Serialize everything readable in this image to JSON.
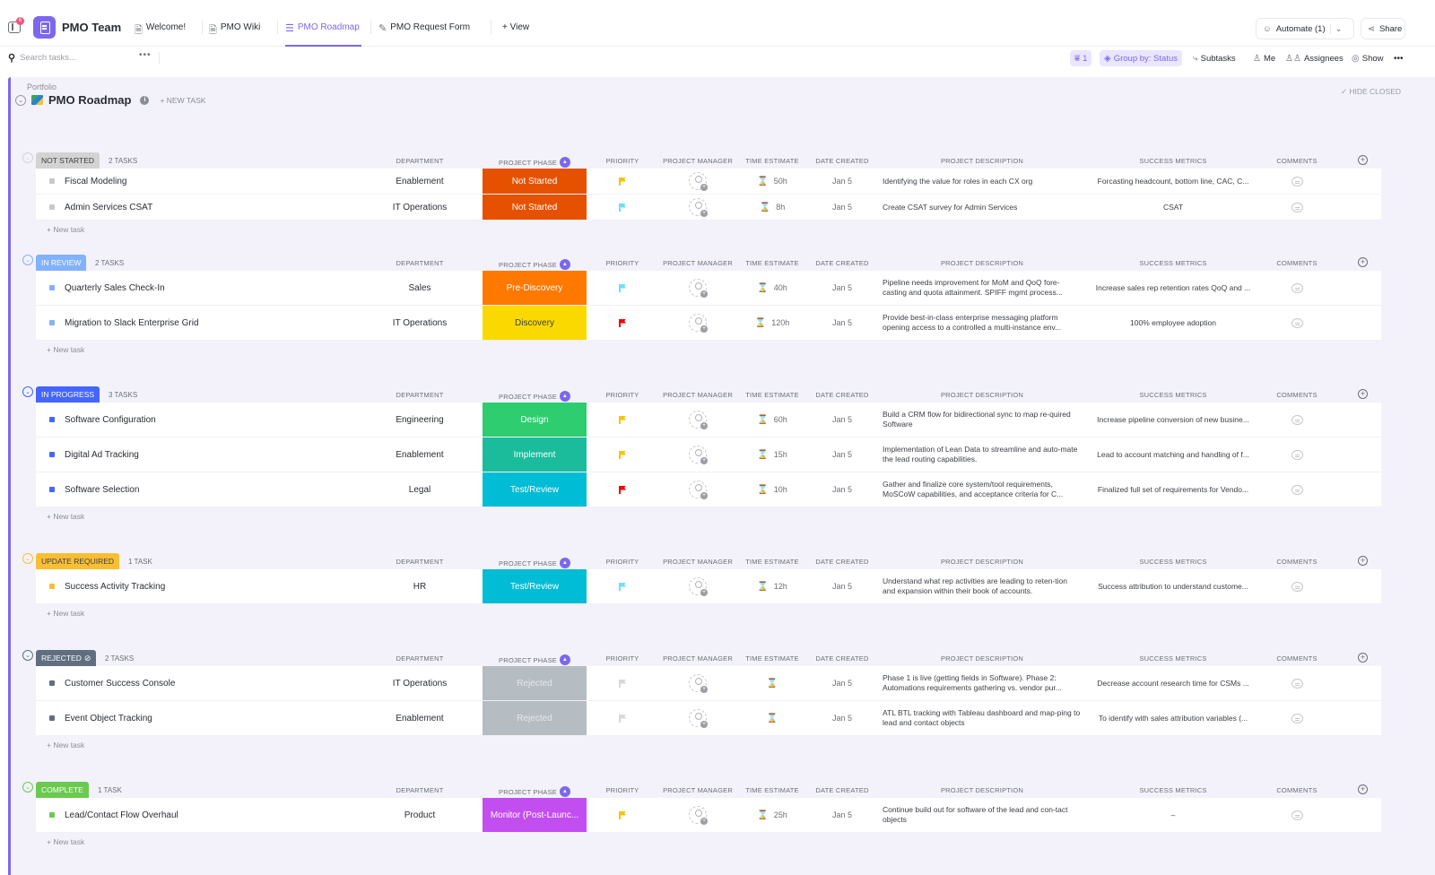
{
  "topbar": {
    "notification_count": "6",
    "space_name": "PMO Team",
    "tabs": [
      {
        "label": "Welcome!",
        "icon": "doc-icon"
      },
      {
        "label": "PMO Wiki",
        "icon": "doc-icon"
      },
      {
        "label": "PMO Roadmap",
        "icon": "list-icon",
        "active": true
      },
      {
        "label": "PMO Request Form",
        "icon": "form-icon"
      }
    ],
    "add_view_label": "+ View",
    "automate_label": "Automate (1)",
    "share_label": "Share"
  },
  "toolbar": {
    "search_placeholder": "Search tasks...",
    "filter_count": "1",
    "group_by_label": "Group by: Status",
    "subtasks_label": "Subtasks",
    "me_label": "Me",
    "assignees_label": "Assignees",
    "show_label": "Show"
  },
  "list": {
    "breadcrumb": "Portfolio",
    "title": "PMO Roadmap",
    "new_task_label": "+ NEW TASK",
    "hide_closed_label": "✓ HIDE CLOSED"
  },
  "columns": {
    "department": "DEPARTMENT",
    "project_phase": "PROJECT PHASE",
    "priority": "PRIORITY",
    "project_manager": "PROJECT MANAGER",
    "time_estimate": "TIME ESTIMATE",
    "date_created": "DATE CREATED",
    "project_description": "PROJECT DESCRIPTION",
    "success_metrics": "SUCCESS METRICS",
    "comments": "COMMENTS"
  },
  "new_task_row_label": "+ New task",
  "groups": [
    {
      "status": "NOT STARTED",
      "count": "2 TASKS",
      "color": "#d3d3d3",
      "text_color": "#3c3f45",
      "square": "#c8c8c8",
      "tasks": [
        {
          "name": "Fiscal Modeling",
          "department": "Enablement",
          "phase": "Not Started",
          "phase_color": "#e65100",
          "priority_color": "#f8c30a",
          "time": "50h",
          "date": "Jan 5",
          "description": "Identifying the value for roles in each CX org",
          "metrics": "Forcasting headcount, bottom line, CAC, C..."
        },
        {
          "name": "Admin Services CSAT",
          "department": "IT Operations",
          "phase": "Not Started",
          "phase_color": "#e65100",
          "priority_color": "#6fddff",
          "time": "8h",
          "date": "Jan 5",
          "description": "Create CSAT survey for Admin Services",
          "metrics": "CSAT"
        }
      ]
    },
    {
      "status": "IN REVIEW",
      "count": "2 TASKS",
      "color": "#81b1ff",
      "text_color": "#ffffff",
      "square": "#81b1ff",
      "tasks": [
        {
          "name": "Quarterly Sales Check-In",
          "department": "Sales",
          "phase": "Pre-Discovery",
          "phase_color": "#ff7800",
          "priority_color": "#6fddff",
          "time": "40h",
          "date": "Jan 5",
          "description": "Pipeline needs improvement for MoM and QoQ fore-casting and quota attainment.  SPIFF mgmt process...",
          "metrics": "Increase sales rep retention rates QoQ and ..."
        },
        {
          "name": "Migration to Slack Enterprise Grid",
          "department": "IT Operations",
          "phase": "Discovery",
          "phase_color": "#f9d900",
          "phase_text_color": "#3c3f45",
          "priority_color": "#f50000",
          "time": "120h",
          "date": "Jan 5",
          "description": "Provide best-in-class enterprise messaging platform opening access to a controlled a multi-instance env...",
          "metrics": "100% employee adoption"
        }
      ]
    },
    {
      "status": "IN PROGRESS",
      "count": "3 TASKS",
      "color": "#4466ff",
      "text_color": "#ffffff",
      "square": "#4466ff",
      "tasks": [
        {
          "name": "Software Configuration",
          "department": "Engineering",
          "phase": "Design",
          "phase_color": "#2ecd6f",
          "priority_color": "#f8c30a",
          "time": "60h",
          "date": "Jan 5",
          "description": "Build a CRM flow for bidirectional sync to map re-quired Software",
          "metrics": "Increase pipeline conversion of new busine..."
        },
        {
          "name": "Digital Ad Tracking",
          "department": "Enablement",
          "phase": "Implement",
          "phase_color": "#1bbc9c",
          "priority_color": "#f8c30a",
          "time": "15h",
          "date": "Jan 5",
          "description": "Implementation of Lean Data to streamline and auto-mate the lead routing capabilities.",
          "metrics": "Lead to account matching and handling of f..."
        },
        {
          "name": "Software Selection",
          "department": "Legal",
          "phase": "Test/Review",
          "phase_color": "#00bcd4",
          "priority_color": "#f50000",
          "time": "10h",
          "date": "Jan 5",
          "description": "Gather and finalize core system/tool requirements, MoSCoW capabilities, and acceptance criteria for C...",
          "metrics": "Finalized full set of requirements for Vendo..."
        }
      ]
    },
    {
      "status": "UPDATE REQUIRED",
      "count": "1 TASK",
      "color": "#f9be33",
      "text_color": "#3c3f45",
      "square": "#f9be33",
      "tasks": [
        {
          "name": "Success Activity Tracking",
          "department": "HR",
          "phase": "Test/Review",
          "phase_color": "#00bcd4",
          "priority_color": "#6fddff",
          "time": "12h",
          "date": "Jan 5",
          "description": "Understand what rep activities are leading to reten-tion and expansion within their book of accounts.",
          "metrics": "Success attribution to understand custome..."
        }
      ]
    },
    {
      "status": "REJECTED",
      "count": "2 TASKS",
      "color": "#606f7f",
      "text_color": "#ffffff",
      "square": "#606f7f",
      "closed": true,
      "tasks": [
        {
          "name": "Customer Success Console",
          "department": "IT Operations",
          "phase": "Rejected",
          "phase_color": "#b5bcc2",
          "phase_text_color": "#e6e8ea",
          "priority_color": "#d6d8db",
          "time": "",
          "date": "Jan 5",
          "description": "Phase 1 is live (getting fields in Software).  Phase 2: Automations requirements gathering vs. vendor pur...",
          "metrics": "Decrease account research time for CSMs ..."
        },
        {
          "name": "Event Object Tracking",
          "department": "Enablement",
          "phase": "Rejected",
          "phase_color": "#b5bcc2",
          "phase_text_color": "#e6e8ea",
          "priority_color": "#d6d8db",
          "time": "",
          "date": "Jan 5",
          "description": "ATL BTL tracking with Tableau dashboard and map-ping to lead and contact objects",
          "metrics": "To identify with sales attribution variables (..."
        }
      ]
    },
    {
      "status": "COMPLETE",
      "count": "1 TASK",
      "color": "#6bc950",
      "text_color": "#ffffff",
      "square": "#6bc950",
      "tasks": [
        {
          "name": "Lead/Contact Flow Overhaul",
          "department": "Product",
          "phase": "Monitor (Post-Launc...",
          "phase_color": "#c34ef0",
          "priority_color": "#f8c30a",
          "time": "25h",
          "date": "Jan 5",
          "description": "Continue build out for software of the lead and con-tact objects",
          "metrics": "–"
        }
      ]
    }
  ]
}
